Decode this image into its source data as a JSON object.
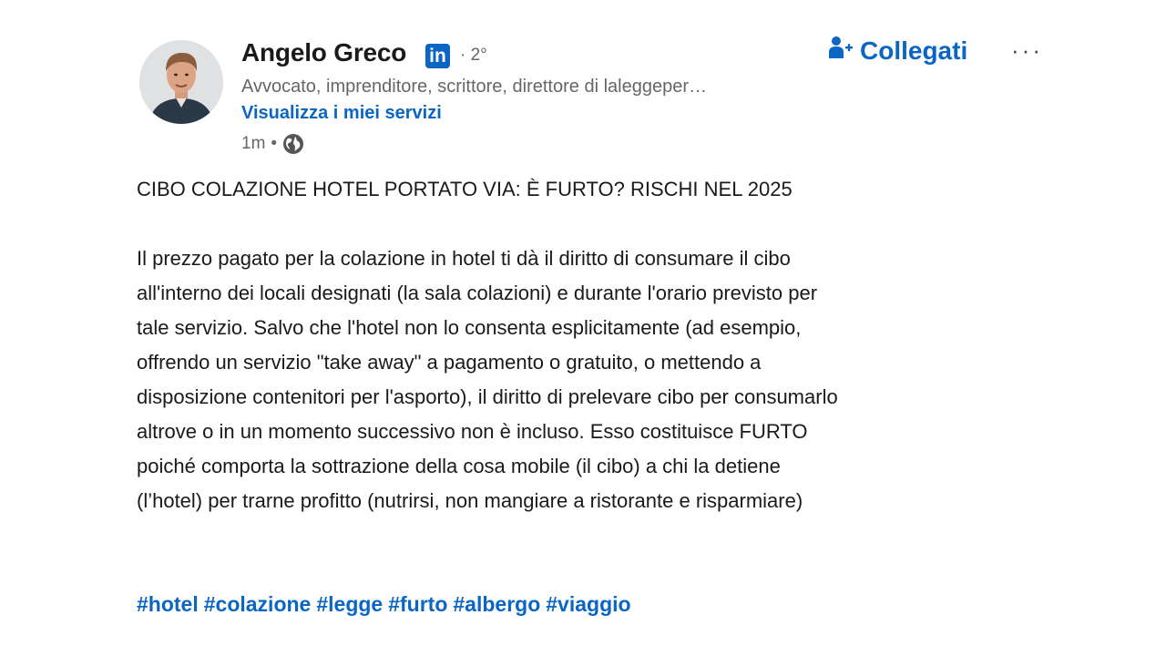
{
  "author": {
    "name": "Angelo Greco",
    "network_badge": "in",
    "degree": "· 2°",
    "headline": "Avvocato, imprenditore, scrittore, direttore di laleggeper…",
    "services_link": "Visualizza i miei servizi",
    "time": "1m",
    "time_separator": "•"
  },
  "actions": {
    "connect_label": "Collegati",
    "more_label": "···"
  },
  "post": {
    "title": "CIBO COLAZIONE HOTEL PORTATO VIA: È FURTO? RISCHI NEL 2025",
    "body_lines": [
      "Il prezzo pagato per la colazione in hotel ti dà il diritto di consumare il cibo",
      "all'interno dei locali designati (la sala colazioni) e durante l'orario previsto per",
      "tale servizio. Salvo che l'hotel non lo consenta esplicitamente (ad esempio,",
      "offrendo un servizio \"take away\" a pagamento o gratuito, o mettendo a",
      "disposizione contenitori per l'asporto), il diritto di prelevare cibo per consumarlo",
      "altrove o in un momento successivo non è incluso. Esso costituisce FURTO",
      "poiché comporta la sottrazione della cosa mobile (il cibo) a chi la detiene",
      "(l’hotel) per trarne profitto (nutrirsi, non mangiare a ristorante e risparmiare)"
    ],
    "hashtags": [
      "#hotel",
      "#colazione",
      "#legge",
      "#furto",
      "#albergo",
      "#viaggio"
    ]
  },
  "colors": {
    "accent": "#0a66c2",
    "text": "#1a1a1a",
    "muted": "#666666"
  },
  "icons": {
    "visibility": "globe-icon",
    "connect": "add-person-icon",
    "network": "linkedin-icon"
  }
}
